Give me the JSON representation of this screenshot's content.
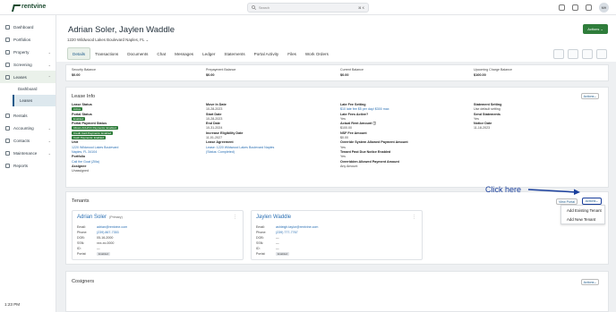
{
  "brand": "rentvine",
  "search": {
    "placeholder": "Search",
    "shortcut": "⌘ K"
  },
  "user_initials": "MH",
  "sidebar": {
    "items": [
      {
        "label": "Dashboard",
        "icon": "dashboard-icon"
      },
      {
        "label": "Portfolios",
        "icon": "portfolio-icon"
      },
      {
        "label": "Property",
        "icon": "property-icon"
      },
      {
        "label": "Screening",
        "icon": "screening-icon"
      },
      {
        "label": "Leases",
        "icon": "leases-icon"
      },
      {
        "label": "Rentals",
        "icon": "rentals-icon"
      },
      {
        "label": "Accounting",
        "icon": "accounting-icon"
      },
      {
        "label": "Contacts",
        "icon": "contacts-icon"
      },
      {
        "label": "Maintenance",
        "icon": "maintenance-icon"
      },
      {
        "label": "Reports",
        "icon": "reports-icon"
      }
    ],
    "sub": [
      "Dashboard",
      "Leases"
    ]
  },
  "clock": "1:23 PM",
  "lease": {
    "title": "Adrian Soler, Jaylen Waddle",
    "address": "1220 Wildwood Lakes Boulevard Naples, FL"
  },
  "actions_label": "Actions",
  "tabs": [
    "Details",
    "Transactions",
    "Documents",
    "Chat",
    "Messages",
    "Ledger",
    "Statements",
    "Portal Activity",
    "Files",
    "Work Orders"
  ],
  "balances": [
    {
      "label": "Security Balance",
      "value": "$0.00"
    },
    {
      "label": "Prepayment Balance",
      "value": "$0.00"
    },
    {
      "label": "Current Balance",
      "value": "$0.00"
    },
    {
      "label": "Upcoming Charge Balance",
      "value": "$100.00"
    }
  ],
  "lease_info": {
    "title": "Lease Info",
    "actions": "Actions",
    "col1": {
      "status_label": "Lease Status",
      "status_value": "Active",
      "portal_status_label": "Portal Status",
      "portal_status_value": "Enabled",
      "payment_label": "Portal Payment Status",
      "payment_pills": [
        "Allows ACH/CC Payments: Enabled",
        "Credit Card Payments: Enabled",
        "Cash Payments: Enabled"
      ],
      "unit_label": "Unit",
      "unit_line1": "1220 Wildwood Lakes Boulevard",
      "unit_line2": "Naples, FL 34104",
      "portfolio_label": "Portfolio",
      "portfolio_value": "Cali the Goat (Zilla)",
      "assignee_label": "Assignee",
      "assignee_value": "Unassigned"
    },
    "col2": {
      "move_in_label": "Move In Date",
      "move_in": "10-28-2023",
      "start_label": "Start Date",
      "start": "10-28-2023",
      "end_label": "End Date",
      "end": "10-31-2024",
      "increase_label": "Increase Eligibility Date",
      "increase": "11-01-2027",
      "agreement_label": "Lease Agreement",
      "agreement_line1": "Lease: 1220 Wildwood Lakes Boulevard Naples",
      "agreement_line2": "(Status: Completed)"
    },
    "col3": {
      "late_fee_label": "Late Fee Setting",
      "late_fee": "$10 late fee $5 per day/ $300 max",
      "late_active_label": "Late Fees Active?",
      "late_active": "Yes",
      "actual_rent_label": "Actual Rent Amount",
      "actual_rent": "$100.00",
      "nsf_label": "NSF Fee Amount",
      "nsf": "$0.00",
      "override_label": "Override System Allowed Payment Amount",
      "override": "Yes",
      "past_due_label": "Tenant Past Due Notice Enabled",
      "past_due": "Yes",
      "overridden_label": "Overridden Allowed Payment Amount",
      "overridden": "Any Amount"
    },
    "col4": {
      "statement_label": "Statement Setting",
      "statement": "Use default setting",
      "send_label": "Send Statements",
      "send": "Yes",
      "notice_label": "Notice Date",
      "notice": "11-18-2023"
    }
  },
  "tenants": {
    "title": "Tenants",
    "view_portal": "View Portal",
    "actions": "Actions",
    "people": [
      {
        "name": "Adrian Soler",
        "primary": "(Primary)",
        "email": "adrian@rentvine.com",
        "phone": "(239) 867-7353",
        "dob": "05-16-2000",
        "ssn": "xxx-xx-0000",
        "id": "—",
        "portal": "Enabled"
      },
      {
        "name": "Jaylen Waddle",
        "primary": "",
        "email": "ashleigh.taylor@rentvine.com",
        "phone": "(239) 777-7767",
        "dob": "—",
        "ssn": "—",
        "id": "—",
        "portal": "Enabled"
      }
    ],
    "labels": {
      "email": "Email:",
      "phone": "Phone:",
      "dob": "DOB:",
      "ssn": "SSN:",
      "id": "ID:",
      "portal": "Portal:"
    }
  },
  "menu": [
    "Add Existing Tenant",
    "Add New Tenant"
  ],
  "cosigners": {
    "title": "Cosigners",
    "actions": "Actions"
  },
  "callout": "Click here"
}
